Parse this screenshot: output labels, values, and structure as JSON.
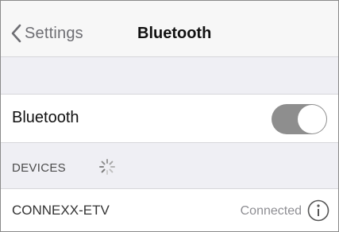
{
  "navbar": {
    "back_label": "Settings",
    "title": "Bluetooth",
    "back_icon": "chevron-left-icon"
  },
  "bluetooth_row": {
    "label": "Bluetooth",
    "toggle_state": "on"
  },
  "devices": {
    "header": "DEVICES",
    "loading_icon": "spinner-icon",
    "items": [
      {
        "name": "CONNEXX-ETV",
        "status": "Connected",
        "info_icon": "info-icon"
      }
    ]
  },
  "colors": {
    "background": "#efeff4",
    "toggle_track": "#8e8e8e",
    "status_text": "#8e8e93"
  }
}
